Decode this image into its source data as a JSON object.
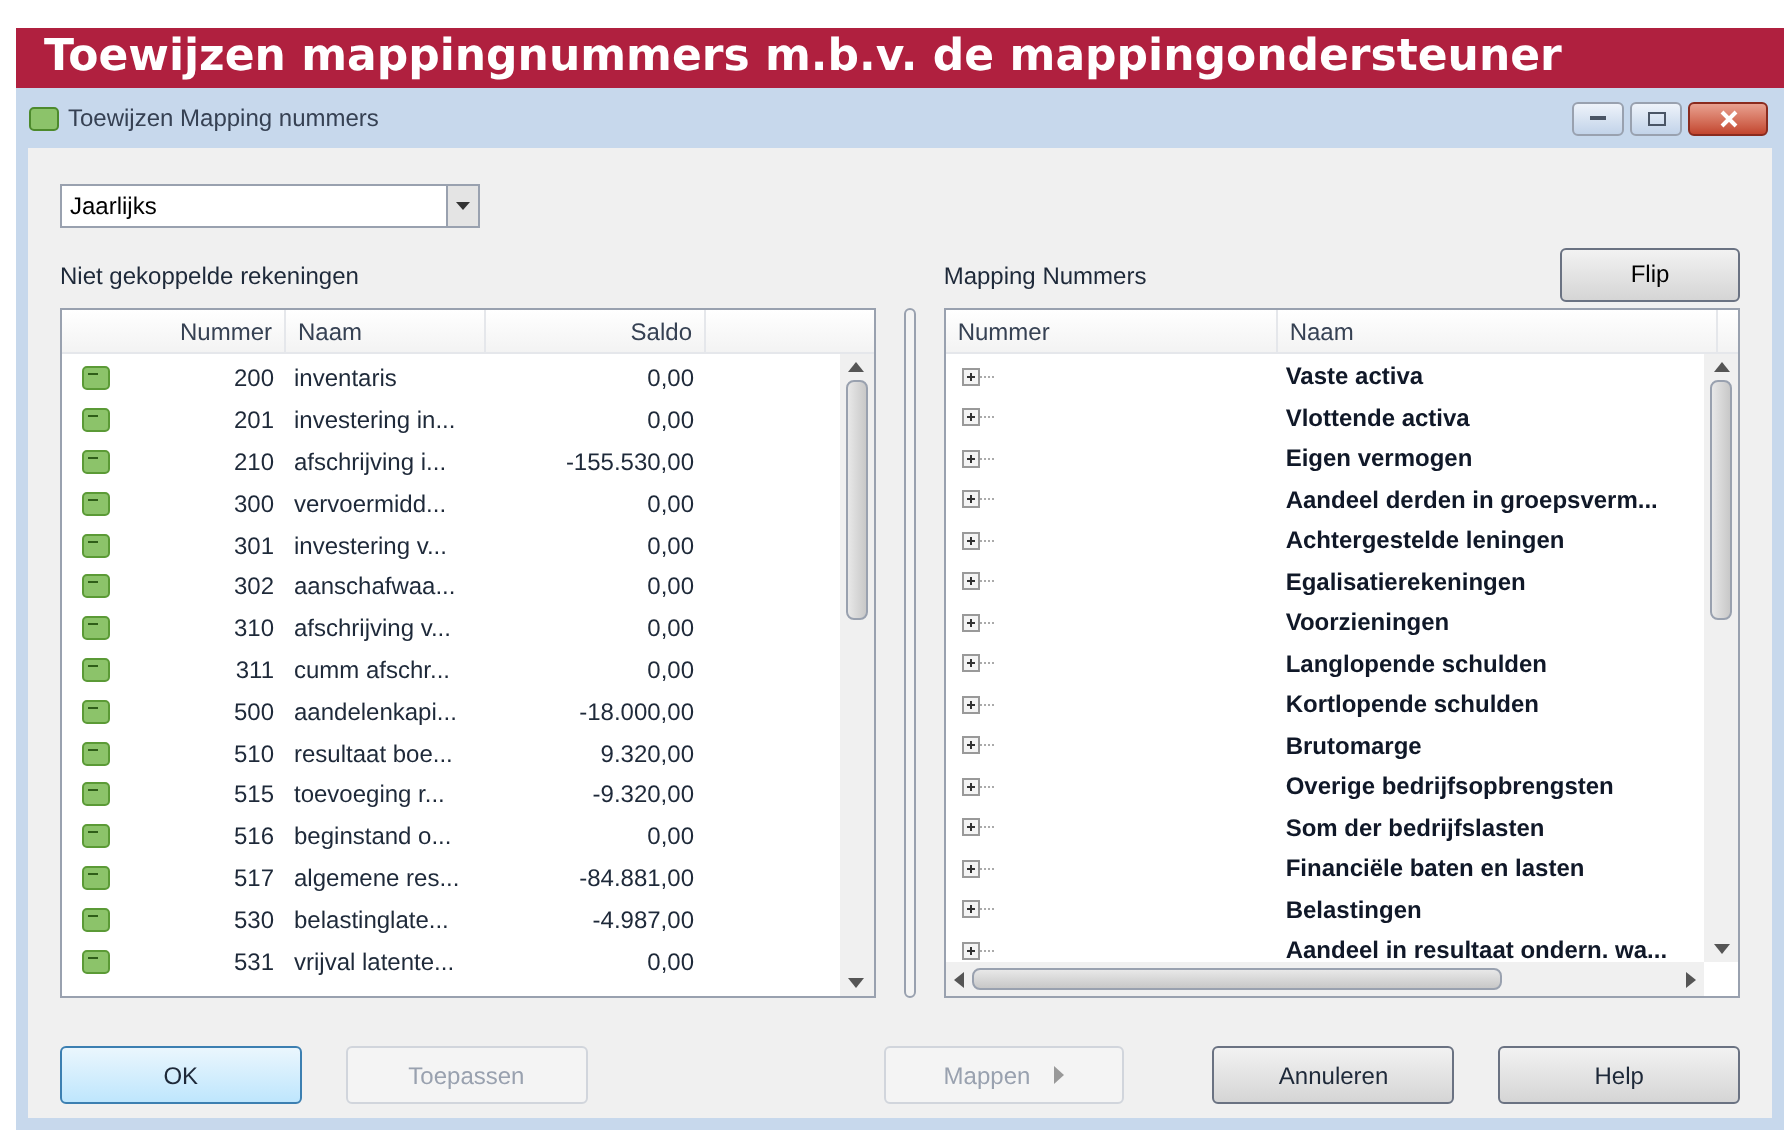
{
  "banner": {
    "title": "Toewijzen mappingnummers m.b.v. de mappingondersteuner"
  },
  "window": {
    "title": "Toewijzen Mapping nummers"
  },
  "period_select": {
    "value": "Jaarlijks"
  },
  "left": {
    "heading": "Niet gekoppelde rekeningen",
    "columns": [
      "Nummer",
      "Naam",
      "Saldo"
    ],
    "rows": [
      {
        "nummer": "200",
        "naam": "inventaris",
        "saldo": "0,00"
      },
      {
        "nummer": "201",
        "naam": "investering in...",
        "saldo": "0,00"
      },
      {
        "nummer": "210",
        "naam": "afschrijving i...",
        "saldo": "-155.530,00"
      },
      {
        "nummer": "300",
        "naam": "vervoermidd...",
        "saldo": "0,00"
      },
      {
        "nummer": "301",
        "naam": "investering v...",
        "saldo": "0,00"
      },
      {
        "nummer": "302",
        "naam": "aanschafwaa...",
        "saldo": "0,00"
      },
      {
        "nummer": "310",
        "naam": "afschrijving v...",
        "saldo": "0,00"
      },
      {
        "nummer": "311",
        "naam": "cumm afschr...",
        "saldo": "0,00"
      },
      {
        "nummer": "500",
        "naam": "aandelenkapi...",
        "saldo": "-18.000,00"
      },
      {
        "nummer": "510",
        "naam": "resultaat boe...",
        "saldo": "9.320,00"
      },
      {
        "nummer": "515",
        "naam": "toevoeging r...",
        "saldo": "-9.320,00"
      },
      {
        "nummer": "516",
        "naam": "beginstand o...",
        "saldo": "0,00"
      },
      {
        "nummer": "517",
        "naam": "algemene res...",
        "saldo": "-84.881,00"
      },
      {
        "nummer": "530",
        "naam": "belastinglate...",
        "saldo": "-4.987,00"
      },
      {
        "nummer": "531",
        "naam": "vrijval latente...",
        "saldo": "0,00"
      }
    ]
  },
  "right": {
    "heading": "Mapping Nummers",
    "flip_button": "Flip",
    "columns": [
      "Nummer",
      "Naam"
    ],
    "items": [
      {
        "naam": "Vaste activa",
        "expanded": false
      },
      {
        "naam": "Vlottende activa",
        "expanded": false
      },
      {
        "naam": "Eigen vermogen",
        "expanded": false
      },
      {
        "naam": "Aandeel derden in groepsverm...",
        "expanded": false
      },
      {
        "naam": "Achtergestelde leningen",
        "expanded": false
      },
      {
        "naam": "Egalisatierekeningen",
        "expanded": false
      },
      {
        "naam": "Voorzieningen",
        "expanded": false
      },
      {
        "naam": "Langlopende schulden",
        "expanded": false
      },
      {
        "naam": "Kortlopende schulden",
        "expanded": false
      },
      {
        "naam": "Brutomarge",
        "expanded": false
      },
      {
        "naam": "Overige bedrijfsopbrengsten",
        "expanded": false
      },
      {
        "naam": "Som der bedrijfslasten",
        "expanded": false
      },
      {
        "naam": "Financiële baten en lasten",
        "expanded": false
      },
      {
        "naam": "Belastingen",
        "expanded": false
      },
      {
        "naam": "Aandeel in resultaat ondern. wa...",
        "expanded": false
      }
    ]
  },
  "buttons": [
    {
      "label": "OK",
      "disabled": false,
      "default": true
    },
    {
      "label": "Toepassen",
      "disabled": true,
      "default": false
    },
    {
      "label": "Mappen",
      "disabled": true,
      "default": false
    },
    {
      "label": "Annuleren",
      "disabled": false,
      "default": false
    },
    {
      "label": "Help",
      "disabled": false,
      "default": false
    }
  ]
}
